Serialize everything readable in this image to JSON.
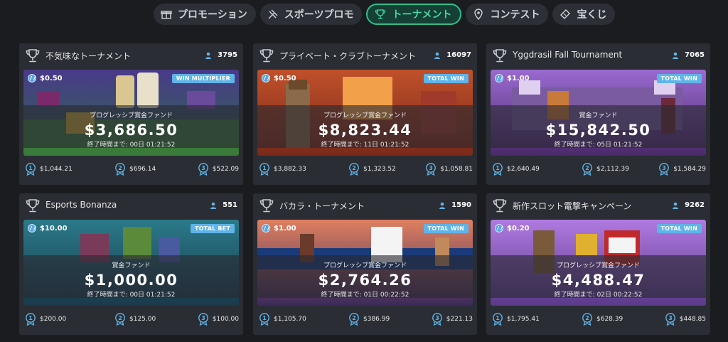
{
  "tabs": [
    {
      "label": "プロモーション",
      "icon": "gift-icon",
      "active": false
    },
    {
      "label": "スポーツプロモ",
      "icon": "sports-icon",
      "active": false
    },
    {
      "label": "トーナメント",
      "icon": "trophy-icon",
      "active": true
    },
    {
      "label": "コンテスト",
      "icon": "pin-icon",
      "active": false
    },
    {
      "label": "宝くじ",
      "icon": "ticket-icon",
      "active": false
    }
  ],
  "colors": {
    "accent": "#2fbf8c",
    "badge": "#5fb4e8",
    "card": "#2a2d33",
    "background": "#1a1c20"
  },
  "tournaments": [
    {
      "title": "不気味なトーナメント",
      "players": "3795",
      "stake": "$0.50",
      "badge": "WIN MULTIPLIER",
      "fund_label": "プログレッシブ賞金ファンド",
      "fund_amount": "$3,686.50",
      "end_label": "終了時間まで:",
      "end_days": "00日",
      "end_time": "01:21:52",
      "prizes": [
        "$1,044.21",
        "$696.14",
        "$522.09"
      ],
      "theme": "spooky"
    },
    {
      "title": "プライベート・クラブトーナメント",
      "players": "16097",
      "stake": "$0.50",
      "badge": "TOTAL WIN",
      "fund_label": "プログレッシブ賞金ファンド",
      "fund_amount": "$8,823.44",
      "end_label": "終了時間まで:",
      "end_days": "11日",
      "end_time": "01:21:52",
      "prizes": [
        "$3,882.33",
        "$1,323.52",
        "$1,058.81"
      ],
      "theme": "club"
    },
    {
      "title": "Yggdrasil Fall Tournament",
      "players": "7065",
      "stake": "$1.00",
      "badge": "TOTAL WIN",
      "fund_label": "賞金ファンド",
      "fund_amount": "$15,842.50",
      "end_label": "終了時間まで:",
      "end_days": "05日",
      "end_time": "01:21:52",
      "prizes": [
        "$2,640.49",
        "$2,112.39",
        "$1,584.29"
      ],
      "theme": "viking"
    },
    {
      "title": "Esports Bonanza",
      "players": "551",
      "stake": "$10.00",
      "badge": "TOTAL BET",
      "fund_label": "賞金ファンド",
      "fund_amount": "$1,000.00",
      "end_label": "終了時間まで:",
      "end_days": "00日",
      "end_time": "01:21:52",
      "prizes": [
        "$200.00",
        "$125.00",
        "$100.00"
      ],
      "theme": "esports"
    },
    {
      "title": "バカラ・トーナメント",
      "players": "1590",
      "stake": "$1.00",
      "badge": "TOTAL WIN",
      "fund_label": "プログレッシブ賞金ファンド",
      "fund_amount": "$2,764.26",
      "end_label": "終了時間まで:",
      "end_days": "01日",
      "end_time": "00:22:52",
      "prizes": [
        "$1,105.70",
        "$386.99",
        "$221.13"
      ],
      "theme": "baccarat"
    },
    {
      "title": "新作スロット電撃キャンペーン",
      "players": "9262",
      "stake": "$0.20",
      "badge": "TOTAL WIN",
      "fund_label": "プログレッシブ賞金ファンド",
      "fund_amount": "$4,488.47",
      "end_label": "終了時間まで:",
      "end_days": "02日",
      "end_time": "00:22:52",
      "prizes": [
        "$1,795.41",
        "$628.39",
        "$448.85"
      ],
      "theme": "slots"
    }
  ]
}
